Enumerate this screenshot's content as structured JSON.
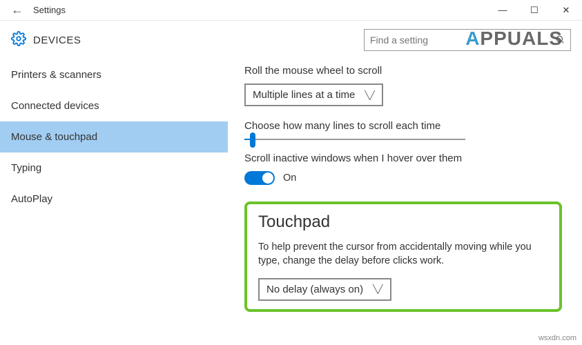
{
  "window": {
    "title": "Settings",
    "back_icon": "←",
    "min": "—",
    "max": "☐",
    "close": "✕"
  },
  "header": {
    "section": "DEVICES",
    "search_placeholder": "Find a setting",
    "search_icon": "🔍"
  },
  "sidebar": {
    "items": [
      {
        "label": "Printers & scanners"
      },
      {
        "label": "Connected devices"
      },
      {
        "label": "Mouse & touchpad"
      },
      {
        "label": "Typing"
      },
      {
        "label": "AutoPlay"
      }
    ],
    "selected_index": 2
  },
  "content": {
    "scroll_wheel_label": "Roll the mouse wheel to scroll",
    "scroll_wheel_value": "Multiple lines at a time",
    "lines_label": "Choose how many lines to scroll each time",
    "inactive_label": "Scroll inactive windows when I hover over them",
    "inactive_value": "On",
    "touchpad": {
      "heading": "Touchpad",
      "description": "To help prevent the cursor from accidentally moving while you type, change the delay before clicks work.",
      "delay_value": "No delay (always on)"
    }
  },
  "watermark": {
    "text_a": "A",
    "text_rest": "PPUALS"
  },
  "footer_mark": "wsxdn.com"
}
